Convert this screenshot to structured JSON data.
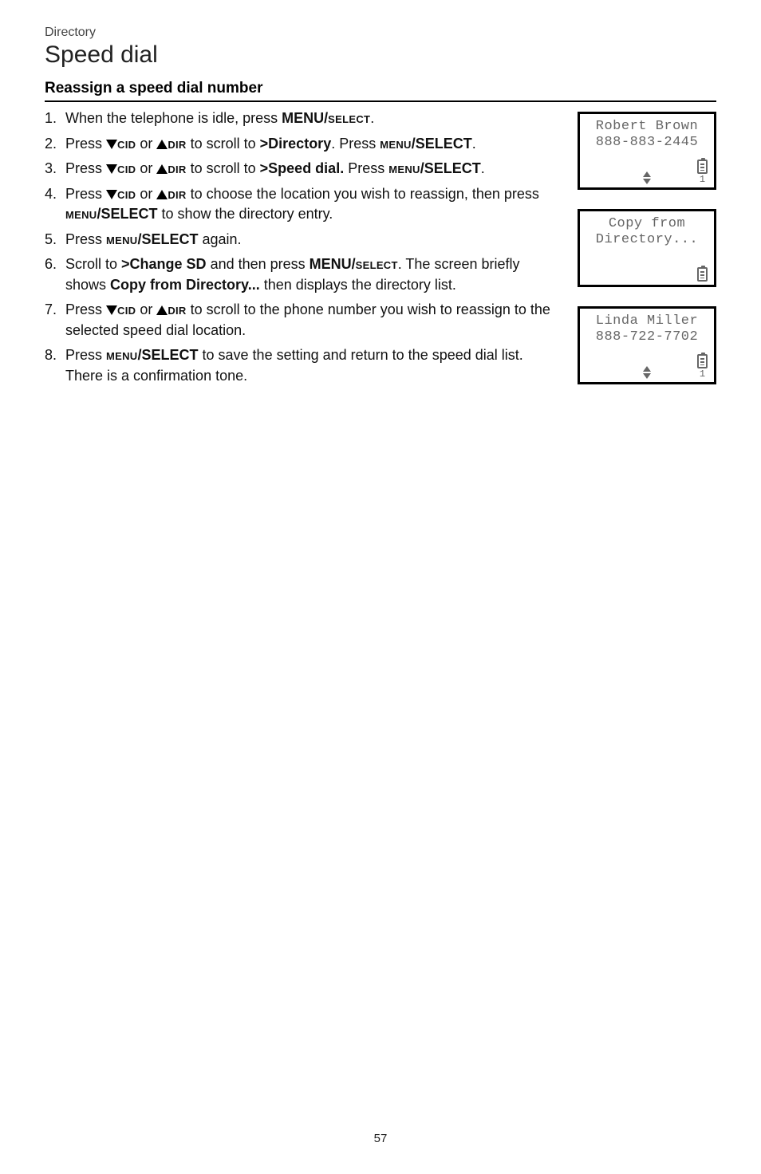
{
  "breadcrumb": "Directory",
  "page_title": "Speed dial",
  "section_title": "Reassign a speed dial number",
  "labels": {
    "cid": "CID",
    "dir": "DIR",
    "menu_select_sc": "MENU/SELECT",
    "menu_sc": "MENU",
    "select_up": "/SELECT",
    "or": " or ",
    "press": "Press ",
    "scroll_to": " to scroll to ",
    "dot": "."
  },
  "steps": {
    "s1_a": "When the telephone is idle, press ",
    "s1_b": "MENU/",
    "s2_target": ">Directory",
    "s2_press": ". Press ",
    "s3_target": ">Speed dial.",
    "s3_press": " Press ",
    "s4_a": " to choose the location you wish to reassign, then press ",
    "s4_b": " to show the directory entry.",
    "s5_a": " again.",
    "s6_a": "Scroll to ",
    "s6_target": ">Change SD",
    "s6_b": " and then press ",
    "s6_c": ". The screen briefly shows ",
    "s6_copy": "Copy from Directory...",
    "s6_d": "  then displays the directory list.",
    "s7_a": " to scroll to the phone number you wish to reassign to the selected speed dial location.",
    "s8_a": " to save the setting and return to the speed dial list. There is a confirmation tone."
  },
  "screens": [
    {
      "line1": "Robert Brown",
      "line2": "888-883-2445",
      "show_arrows": true,
      "show_one": true
    },
    {
      "line1": "Copy from",
      "line2": "Directory...",
      "show_arrows": false,
      "show_one": false
    },
    {
      "line1": "Linda Miller",
      "line2": "888-722-7702",
      "show_arrows": true,
      "show_one": true
    }
  ],
  "page_number": "57"
}
